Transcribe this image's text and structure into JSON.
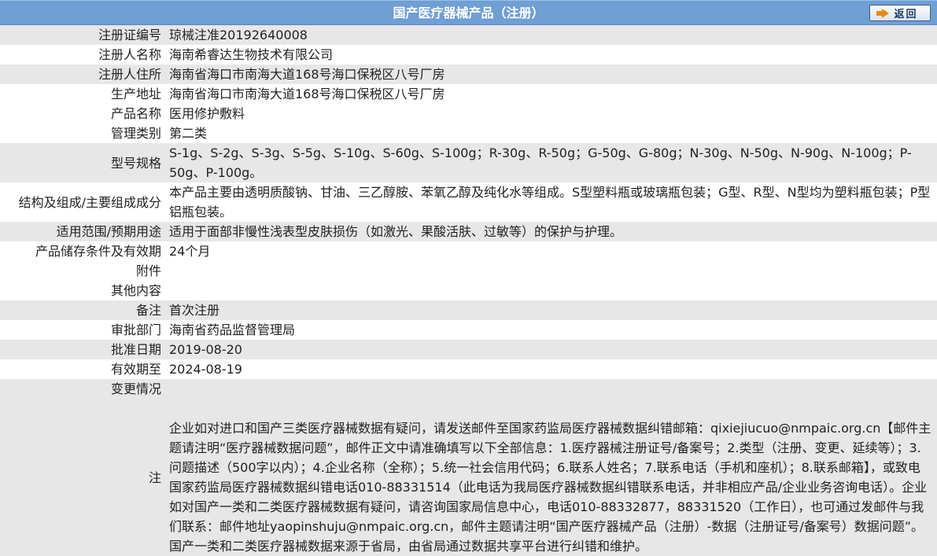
{
  "header": {
    "title": "国产医疗器械产品（注册）",
    "back_label": "返回"
  },
  "rows": [
    {
      "label": "注册证编号",
      "value": "琼械注准20192640008"
    },
    {
      "label": "注册人名称",
      "value": "海南希睿达生物技术有限公司"
    },
    {
      "label": "注册人住所",
      "value": "海南省海口市南海大道168号海口保税区八号厂房"
    },
    {
      "label": "生产地址",
      "value": "海南省海口市南海大道168号海口保税区八号厂房"
    },
    {
      "label": "产品名称",
      "value": "医用修护敷料"
    },
    {
      "label": "管理类别",
      "value": "第二类"
    },
    {
      "label": "型号规格",
      "value": "S-1g、S-2g、S-3g、S-5g、S-10g、S-60g、S-100g；R-30g、R-50g；G-50g、G-80g；N-30g、N-50g、N-90g、N-100g；P-50g、P-100g。"
    },
    {
      "label": "结构及组成/主要组成成分",
      "value": "本产品主要由透明质酸钠、甘油、三乙醇胺、苯氧乙醇及纯化水等组成。S型塑料瓶或玻璃瓶包装；G型、R型、N型均为塑料瓶包装；P型铝瓶包装。"
    },
    {
      "label": "适用范围/预期用途",
      "value": "适用于面部非慢性浅表型皮肤损伤（如激光、果酸活肤、过敏等）的保护与护理。"
    },
    {
      "label": "产品储存条件及有效期",
      "value": "24个月"
    },
    {
      "label": "附件",
      "value": ""
    },
    {
      "label": "其他内容",
      "value": ""
    },
    {
      "label": "备注",
      "value": "首次注册"
    },
    {
      "label": "审批部门",
      "value": "海南省药品监督管理局"
    },
    {
      "label": "批准日期",
      "value": "2019-08-20"
    },
    {
      "label": "有效期至",
      "value": "2024-08-19"
    },
    {
      "label": "变更情况",
      "value": ""
    }
  ],
  "note": {
    "label": "注",
    "text": "企业如对进口和国产三类医疗器械数据有疑问，请发送邮件至国家药监局医疗器械数据纠错邮箱：qixiejiucuo@nmpaic.org.cn【邮件主题请注明“医疗器械数据问题”，邮件正文中请准确填写以下全部信息：1.医疗器械注册证号/备案号；2.类型（注册、变更、延续等）；3.问题描述（500字以内）；4.企业名称（全称）；5.统一社会信用代码；6.联系人姓名；7.联系电话（手机和座机）；8.联系邮箱】，或致电国家药监局医疗器械数据纠错电话010-88331514（此电话为我局医疗器械数据纠错联系电话，并非相应产品/企业业务咨询电话）。企业如对国产一类和二类医疗器械数据有疑问，请咨询国家局信息中心，电话010-88332877，88331520（工作日），也可通过发邮件与我们联系：邮件地址yaopinshuju@nmpaic.org.cn，邮件主题请注明“国产医疗器械产品（注册）-数据（注册证号/备案号）数据问题”。国产一类和二类医疗器械数据来源于省局，由省局通过数据共享平台进行纠错和维护。"
  }
}
